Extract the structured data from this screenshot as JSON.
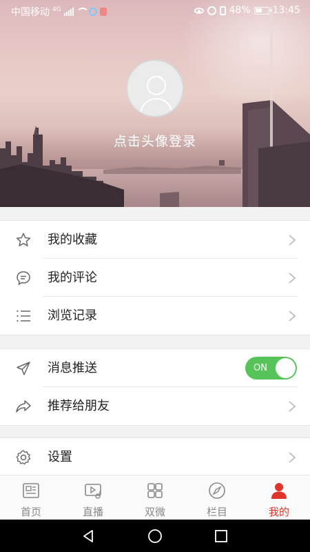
{
  "status_bar": {
    "carrier": "中国移动",
    "network": "4G",
    "battery": "48%",
    "time": "13:45"
  },
  "header": {
    "login_prompt": "点击头像登录"
  },
  "menu_group_1": [
    {
      "label": "我的收藏",
      "icon": "star-icon"
    },
    {
      "label": "我的评论",
      "icon": "comment-icon"
    },
    {
      "label": "浏览记录",
      "icon": "list-icon"
    }
  ],
  "menu_group_2": {
    "push": {
      "label": "消息推送",
      "icon": "send-icon",
      "toggle_text": "ON",
      "toggle_on": true
    },
    "share": {
      "label": "推荐给朋友",
      "icon": "share-icon"
    }
  },
  "menu_group_3": {
    "settings": {
      "label": "设置",
      "icon": "gear-icon"
    }
  },
  "tabbar": {
    "active_color": "#e0342b",
    "inactive_color": "#888888",
    "tabs": [
      {
        "label": "首页",
        "icon": "news-icon",
        "active": false
      },
      {
        "label": "直播",
        "icon": "live-icon",
        "active": false
      },
      {
        "label": "双微",
        "icon": "grid-icon",
        "active": false
      },
      {
        "label": "栏目",
        "icon": "compass-icon",
        "active": false
      },
      {
        "label": "我的",
        "icon": "person-icon",
        "active": true
      }
    ]
  }
}
